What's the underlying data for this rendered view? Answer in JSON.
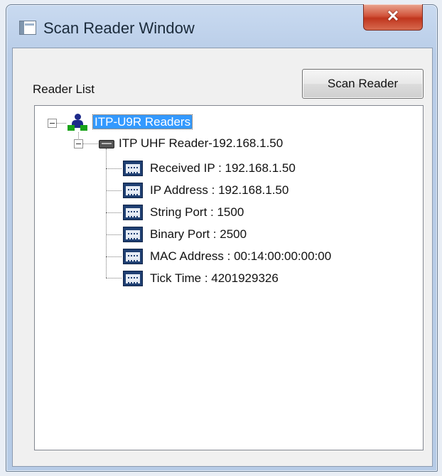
{
  "window": {
    "title": "Scan Reader Window",
    "close_glyph": "✕"
  },
  "panel": {
    "reader_list_label": "Reader List",
    "scan_button_label": "Scan Reader"
  },
  "tree": {
    "root": "ITP-U9R Readers",
    "reader": "ITP UHF Reader-192.168.1.50",
    "details": [
      "Received IP : 192.168.1.50",
      "IP Address : 192.168.1.50",
      "String Port : 1500",
      "Binary Port : 2500",
      "MAC Address : 00:14:00:00:00:00",
      "Tick Time : 4201929326"
    ]
  },
  "colors": {
    "selection": "#3399ff",
    "close_button": "#c0361e"
  }
}
